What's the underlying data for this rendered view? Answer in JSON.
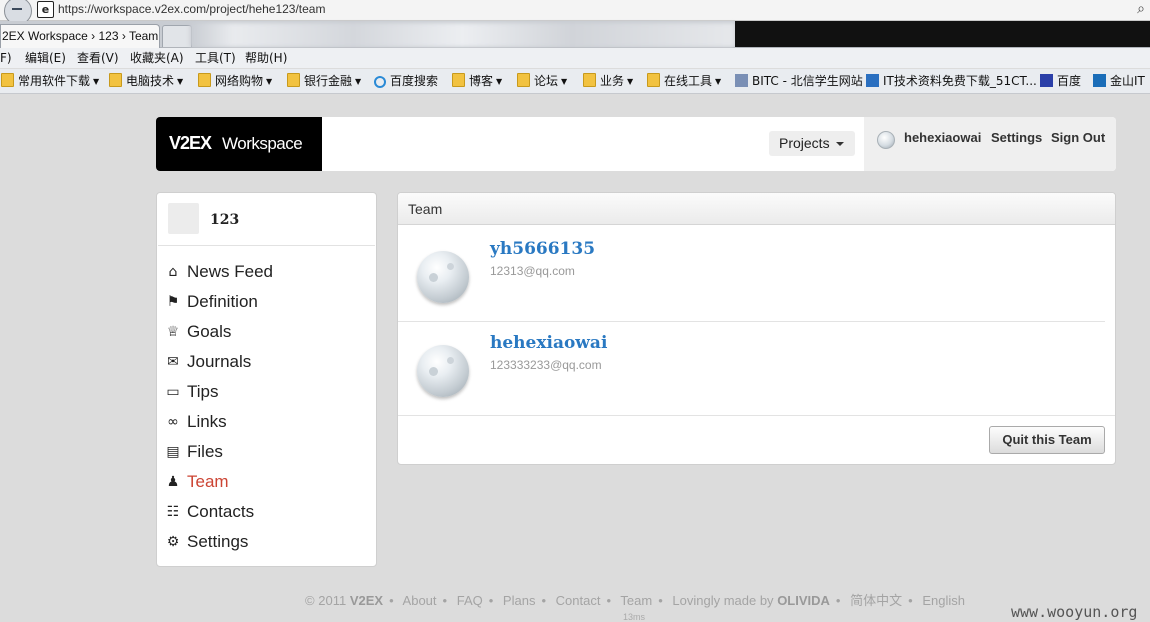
{
  "browser": {
    "url": "https://workspace.v2ex.com/project/hehe123/team",
    "tab_title": "2EX Workspace › 123 › Team",
    "menu": [
      "F)",
      "编辑(E)",
      "查看(V)",
      "收藏夹(A)",
      "工具(T)",
      "帮助(H)"
    ],
    "favorites": [
      {
        "label": "常用软件下载",
        "icon": "folder-icon",
        "dropdown": true
      },
      {
        "label": "电脑技术",
        "icon": "folder-icon",
        "dropdown": true
      },
      {
        "label": "网络购物",
        "icon": "folder-icon",
        "dropdown": true
      },
      {
        "label": "银行金融",
        "icon": "folder-icon",
        "dropdown": true
      },
      {
        "label": "百度搜索",
        "icon": "ie-icon",
        "dropdown": false
      },
      {
        "label": "博客",
        "icon": "folder-icon",
        "dropdown": true
      },
      {
        "label": "论坛",
        "icon": "folder-icon",
        "dropdown": true
      },
      {
        "label": "业务",
        "icon": "folder-icon",
        "dropdown": true
      },
      {
        "label": "在线工具",
        "icon": "folder-icon",
        "dropdown": true
      },
      {
        "label": "BITC - 北信学生网站",
        "icon": "bitc-icon",
        "dropdown": false
      },
      {
        "label": "IT技术资料免费下载_51CT...",
        "icon": "page-icon",
        "dropdown": false
      },
      {
        "label": "百度",
        "icon": "baidu-paw-icon",
        "dropdown": false
      },
      {
        "label": "金山IT",
        "icon": "kingsoft-icon",
        "dropdown": false
      }
    ]
  },
  "header": {
    "logo_bold": "V2EX",
    "logo_rest": "Workspace",
    "projects_label": "Projects",
    "username": "hehexiaowai",
    "settings_label": "Settings",
    "signout_label": "Sign Out"
  },
  "sidebar": {
    "project_name": "123",
    "items": [
      {
        "label": "News Feed",
        "icon": "home-icon",
        "glyph": "⌂"
      },
      {
        "label": "Definition",
        "icon": "flag-icon",
        "glyph": "⚑"
      },
      {
        "label": "Goals",
        "icon": "trophy-icon",
        "glyph": "♕"
      },
      {
        "label": "Journals",
        "icon": "comments-icon",
        "glyph": "✉"
      },
      {
        "label": "Tips",
        "icon": "inbox-icon",
        "glyph": "▭"
      },
      {
        "label": "Links",
        "icon": "link-icon",
        "glyph": "∞"
      },
      {
        "label": "Files",
        "icon": "folder-open-icon",
        "glyph": "▤"
      },
      {
        "label": "Team",
        "icon": "users-icon",
        "glyph": "♟",
        "active": true
      },
      {
        "label": "Contacts",
        "icon": "address-card-icon",
        "glyph": "☷"
      },
      {
        "label": "Settings",
        "icon": "gear-icon",
        "glyph": "⚙"
      }
    ]
  },
  "team": {
    "title": "Team",
    "members": [
      {
        "name": "yh5666135",
        "email": "12313@qq.com"
      },
      {
        "name": "hehexiaowai",
        "email": "123333233@qq.com"
      }
    ],
    "quit_label": "Quit this Team"
  },
  "footer": {
    "copyright": "© 2011",
    "brand": "V2EX",
    "links": [
      "About",
      "FAQ",
      "Plans",
      "Contact",
      "Team"
    ],
    "made_by_prefix": "Lovingly made by",
    "made_by": "OLIVIDA",
    "lang_zh": "简体中文",
    "lang_en": "English",
    "render_time": "13ms"
  },
  "watermark": "www.wooyun.org",
  "colors": {
    "accent_link": "#2a79c2",
    "active_nav": "#cc4433",
    "page_bg": "#dcdcdc"
  }
}
